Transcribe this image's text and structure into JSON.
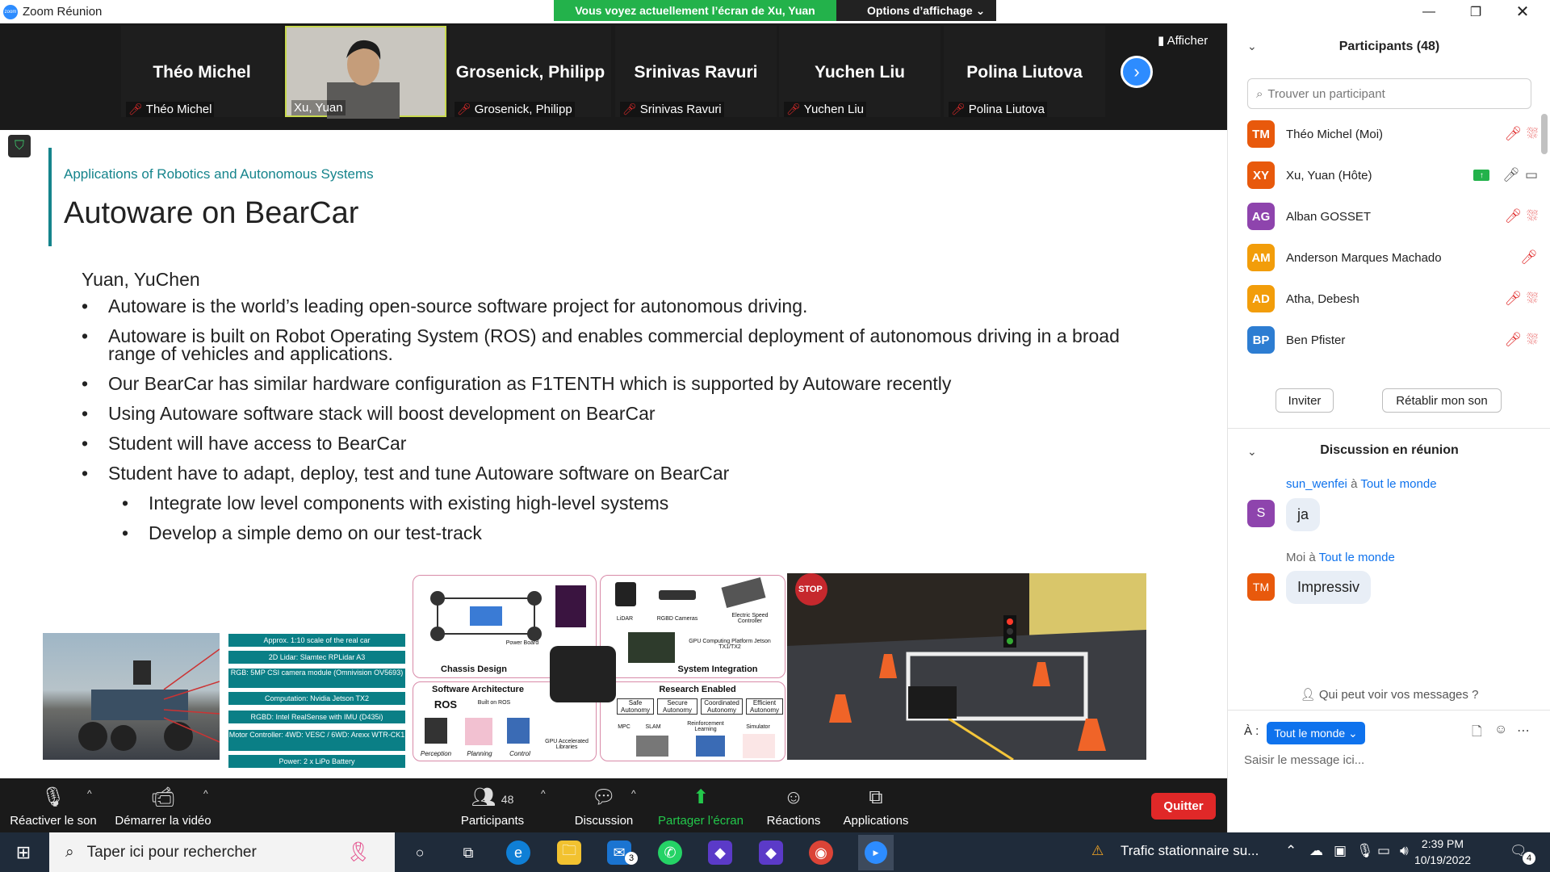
{
  "window": {
    "title": "Zoom Réunion",
    "logo_text": "zoom"
  },
  "view_banner": {
    "status": "Vous voyez actuellement l’écran de Xu, Yuan",
    "options": "Options d’affichage"
  },
  "video_strip": {
    "tiles": [
      {
        "big": "Théo Michel",
        "label": "Théo Michel"
      },
      {
        "big": "",
        "label": "Xu, Yuan"
      },
      {
        "big": "Grosenick, Philipp",
        "label": "Grosenick, Philipp"
      },
      {
        "big": "Srinivas Ravuri",
        "label": "Srinivas Ravuri"
      },
      {
        "big": "Yuchen Liu",
        "label": "Yuchen Liu"
      },
      {
        "big": "Polina Liutova",
        "label": "Polina Liutova"
      }
    ],
    "afficher": "Afficher"
  },
  "slide": {
    "subtitle": "Applications of Robotics and Autonomous Systems",
    "title": "Autoware on BearCar",
    "authors": "Yuan, YuChen",
    "bullets": [
      "Autoware is the world’s leading open-source software project for autonomous driving.",
      "Autoware is built on Robot Operating System (ROS) and enables commercial deployment of autonomous driving in a broad range of vehicles and applications.",
      "Our BearCar has similar hardware configuration as F1TENTH which is supported by Autoware recently",
      "Using Autoware software stack will boost development on BearCar",
      "Student will have access to BearCar",
      "Student have to adapt, deploy, test and tune Autoware software on BearCar"
    ],
    "sub_bullets": [
      "Integrate low level components with existing high-level systems",
      "Develop a simple demo on our test-track"
    ],
    "specs": [
      "Approx. 1:10 scale of the real car",
      "2D Lidar: Slamtec RPLidar A3",
      "RGB: 5MP CSI camera module (Omnivision OV5693)",
      "Computation: Nvidia Jetson TX2",
      "RGBD: Intel RealSense with IMU (D435i)",
      "Motor Controller: 4WD: VESC / 6WD: Arexx WTR-CK1",
      "Power: 2 x LiPo Battery"
    ],
    "diagram": {
      "chassis": "Chassis Design",
      "power_board": "Power Board",
      "lidar": "LiDAR",
      "rgbd": "RGBD Cameras",
      "esc": "Electric Speed Controller",
      "gpu_platform": "GPU Computing Platform Jetson TX1/TX2",
      "system_integration": "System Integration",
      "software_arch": "Software Architecture",
      "ros": "ROS",
      "built_on_ros": "Built on ROS",
      "perception": "Perception",
      "planning": "Planning",
      "control": "Control",
      "gpu_libs": "GPU Accelerated Libraries",
      "research": "Research Enabled",
      "safe": "Safe Autonomy",
      "secure": "Secure Autonomy",
      "coordinated": "Coordinated Autonomy",
      "efficient": "Efficient Autonomy",
      "mpc": "MPC",
      "slam": "SLAM",
      "rl": "Reinforcement Learning",
      "simulator": "Simulator"
    },
    "stop_sign": "STOP"
  },
  "toolbar": {
    "unmute": "Réactiver le son",
    "start_video": "Démarrer la vidéo",
    "participants": "Participants",
    "participants_count": "48",
    "chat": "Discussion",
    "share": "Partager l’écran",
    "reactions": "Réactions",
    "apps": "Applications",
    "quit": "Quitter"
  },
  "panel": {
    "participants_title": "Participants (48)",
    "search_placeholder": "Trouver un participant",
    "participants": [
      {
        "initials": "TM",
        "name": "Théo Michel (Moi)",
        "color": "#e8590c"
      },
      {
        "initials": "XY",
        "name": "Xu, Yuan (Hôte)",
        "color": "#e8590c"
      },
      {
        "initials": "AG",
        "name": "Alban GOSSET",
        "color": "#8e44ad"
      },
      {
        "initials": "AM",
        "name": "Anderson Marques Machado",
        "color": "#f29d0a"
      },
      {
        "initials": "AD",
        "name": "Atha, Debesh",
        "color": "#f29d0a"
      },
      {
        "initials": "BP",
        "name": "Ben Pfister",
        "color": "#2d7dd2"
      }
    ],
    "invite": "Inviter",
    "restore_sound": "Rétablir mon son",
    "chat_title": "Discussion en réunion",
    "messages": [
      {
        "sender": "sun_wenfei",
        "to_word": "à",
        "recipient": "Tout le monde",
        "initial": "S",
        "text": "ja",
        "color": "#8e44ad"
      },
      {
        "sender": "Moi",
        "to_word": "à",
        "recipient": "Tout le monde",
        "initial": "TM",
        "text": "Impressiv",
        "color": "#e8590c"
      }
    ],
    "who_can_see": "Qui peut voir vos messages ?",
    "to_label": "À :",
    "to_value": "Tout le monde",
    "message_placeholder": "Saisir le message ici..."
  },
  "taskbar": {
    "search": "Taper ici pour rechercher",
    "notification": "Trafic stationnaire su...",
    "time": "2:39 PM",
    "date": "10/19/2022",
    "mail_badge": "3",
    "notif_count": "4"
  }
}
